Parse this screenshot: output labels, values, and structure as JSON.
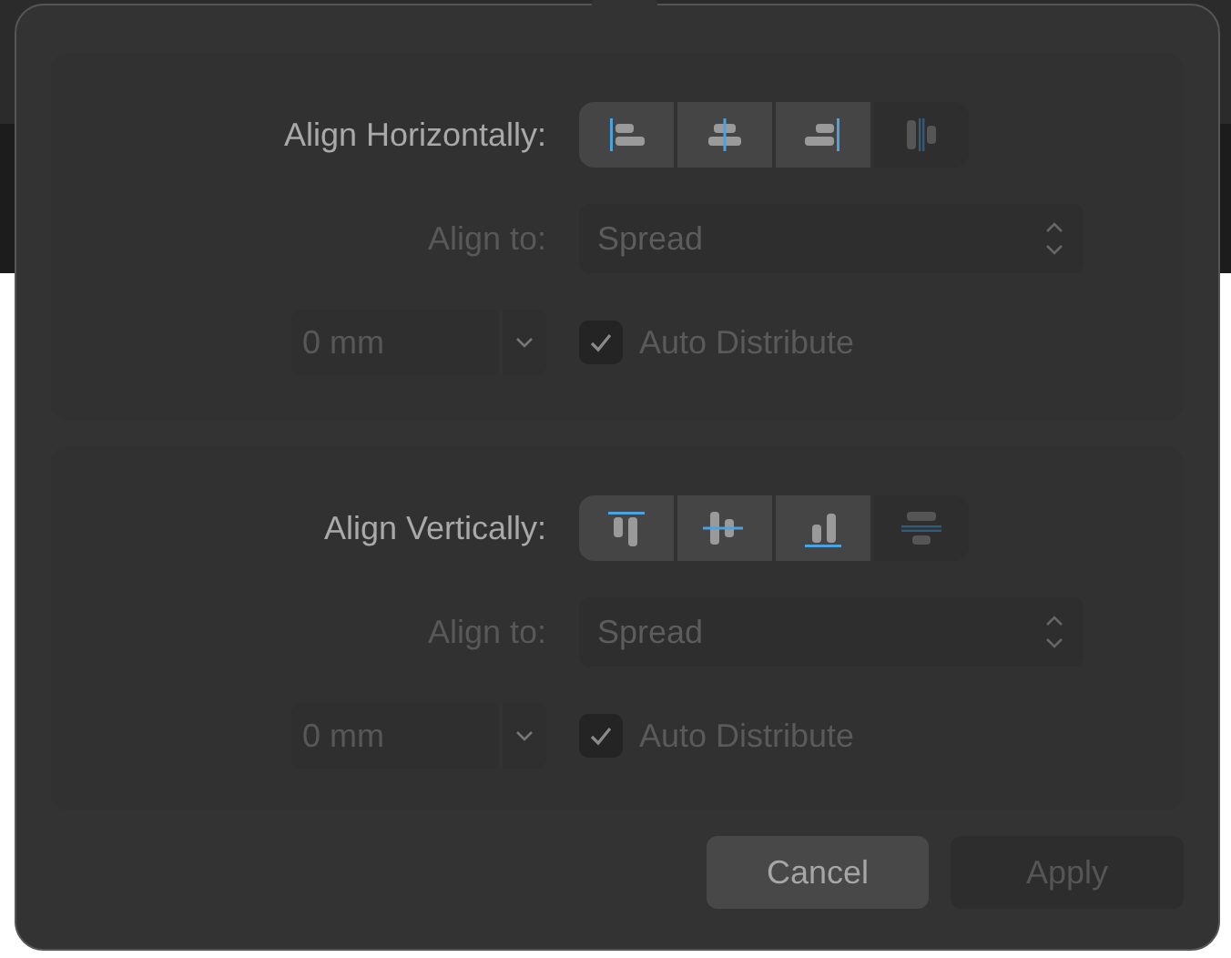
{
  "sections": [
    {
      "label": "Align Horizontally:",
      "buttons": [
        {
          "kind": "h-left",
          "disabled": false
        },
        {
          "kind": "h-center",
          "disabled": false
        },
        {
          "kind": "h-right",
          "disabled": false
        },
        {
          "kind": "h-distribute",
          "disabled": true
        }
      ],
      "align_to": {
        "label": "Align to:",
        "value": "Spread",
        "disabled": true
      },
      "spacing": {
        "value": "0 mm",
        "disabled": true
      },
      "auto_distribute": {
        "label": "Auto Distribute",
        "checked": true,
        "disabled": true
      }
    },
    {
      "label": "Align Vertically:",
      "buttons": [
        {
          "kind": "v-top",
          "disabled": false
        },
        {
          "kind": "v-middle",
          "disabled": false
        },
        {
          "kind": "v-bottom",
          "disabled": false
        },
        {
          "kind": "v-distribute",
          "disabled": true
        }
      ],
      "align_to": {
        "label": "Align to:",
        "value": "Spread",
        "disabled": true
      },
      "spacing": {
        "value": "0 mm",
        "disabled": true
      },
      "auto_distribute": {
        "label": "Auto Distribute",
        "checked": true,
        "disabled": true
      }
    }
  ],
  "buttons": [
    {
      "label": "Cancel",
      "disabled": false
    },
    {
      "label": "Apply",
      "disabled": true
    }
  ]
}
